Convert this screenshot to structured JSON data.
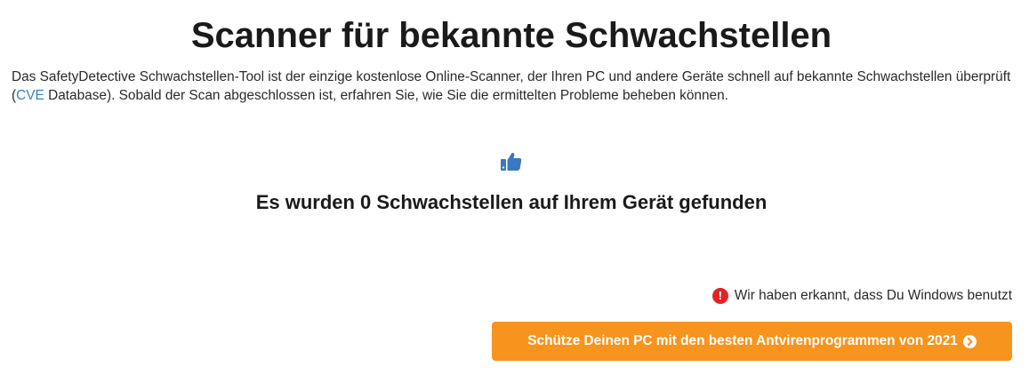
{
  "header": {
    "title": "Scanner für bekannte Schwachstellen"
  },
  "intro": {
    "text_before_link": "Das SafetyDetective Schwachstellen-Tool ist der einzige kostenlose Online-Scanner, der Ihren PC und andere Geräte schnell auf bekannte Schwachstellen überprüft (",
    "link_text": "CVE",
    "text_after_link": " Database). Sobald der Scan abgeschlossen ist, erfahren Sie, wie Sie die ermittelten Probleme beheben können."
  },
  "result": {
    "icon": "thumbs-up-icon",
    "message": "Es wurden 0 Schwachstellen auf Ihrem Gerät gefunden"
  },
  "detection": {
    "icon": "exclamation-circle-icon",
    "text": "Wir haben erkannt, dass Du Windows benutzt"
  },
  "cta": {
    "label": "Schütze Deinen PC mit den besten Antvirenprogrammen von 2021",
    "icon": "chevron-circle-right-icon"
  },
  "colors": {
    "accent_orange": "#f7941d",
    "link_blue": "#3b7fc4",
    "thumb_blue": "#3a78c2",
    "alert_red": "#e02424"
  }
}
